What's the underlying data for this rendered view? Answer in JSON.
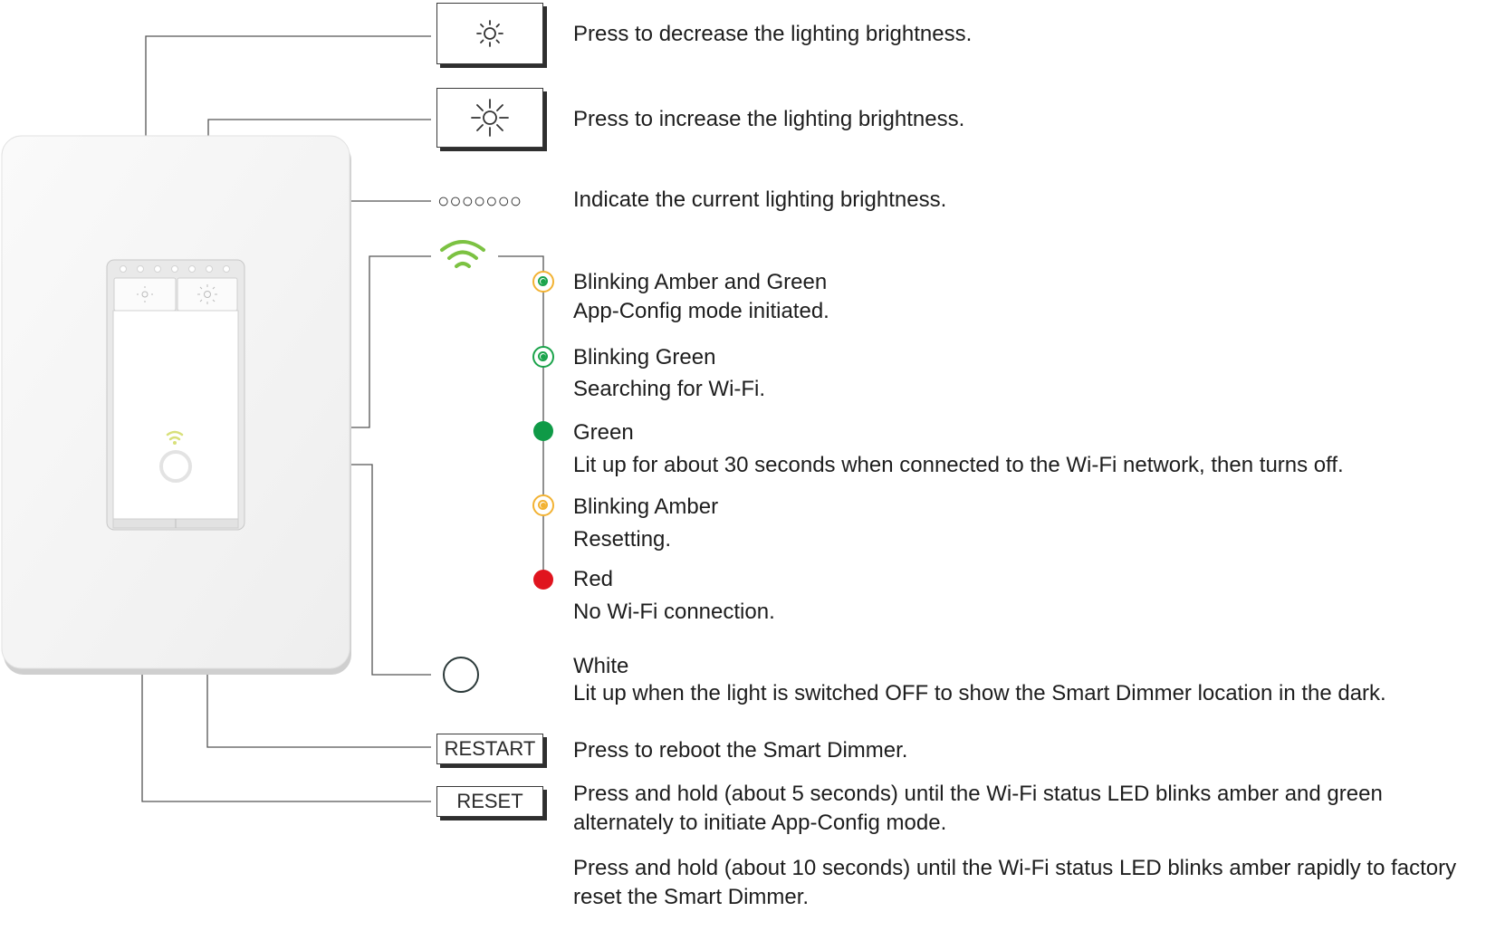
{
  "controls": {
    "dim_down": {
      "icon": "sun-small-icon",
      "description": "Press to decrease the lighting brightness."
    },
    "dim_up": {
      "icon": "sun-large-icon",
      "description": "Press to increase the lighting brightness."
    },
    "brightness_indicator": {
      "glyph": "○○○○○○○",
      "description": "Indicate the current lighting brightness."
    },
    "restart": {
      "label": "RESTART",
      "description": "Press to reboot the Smart Dimmer."
    },
    "reset": {
      "label": "RESET",
      "description_1": "Press and hold (about 5 seconds) until the Wi-Fi status LED blinks amber and green alternately to initiate App-Config mode.",
      "description_2": "Press and hold (about 10 seconds) until the Wi-Fi status LED blinks amber rapidly to factory reset the Smart Dimmer."
    }
  },
  "wifi_led_states": [
    {
      "name": "Blinking Amber and Green",
      "meaning": "App-Config mode initiated.",
      "color": "#f2b233",
      "ring": "#1aa34a"
    },
    {
      "name": "Blinking Green",
      "meaning": "Searching for Wi-Fi.",
      "color": "#1aa34a",
      "ring": "#1aa34a"
    },
    {
      "name": "Green",
      "meaning": "Lit up for about 30 seconds when connected to the Wi-Fi network, then turns off.",
      "color": "#0f9a47"
    },
    {
      "name": "Blinking Amber",
      "meaning": "Resetting.",
      "color": "#f2b233",
      "ring": "#f2b233"
    },
    {
      "name": "Red",
      "meaning": "No Wi-Fi connection.",
      "color": "#e0141e"
    }
  ],
  "locator_led": {
    "name": "White",
    "meaning": "Lit up when the light is switched OFF to show the Smart Dimmer location in the dark."
  },
  "colors": {
    "wifi_icon": "#7cc242",
    "line": "#555555"
  }
}
